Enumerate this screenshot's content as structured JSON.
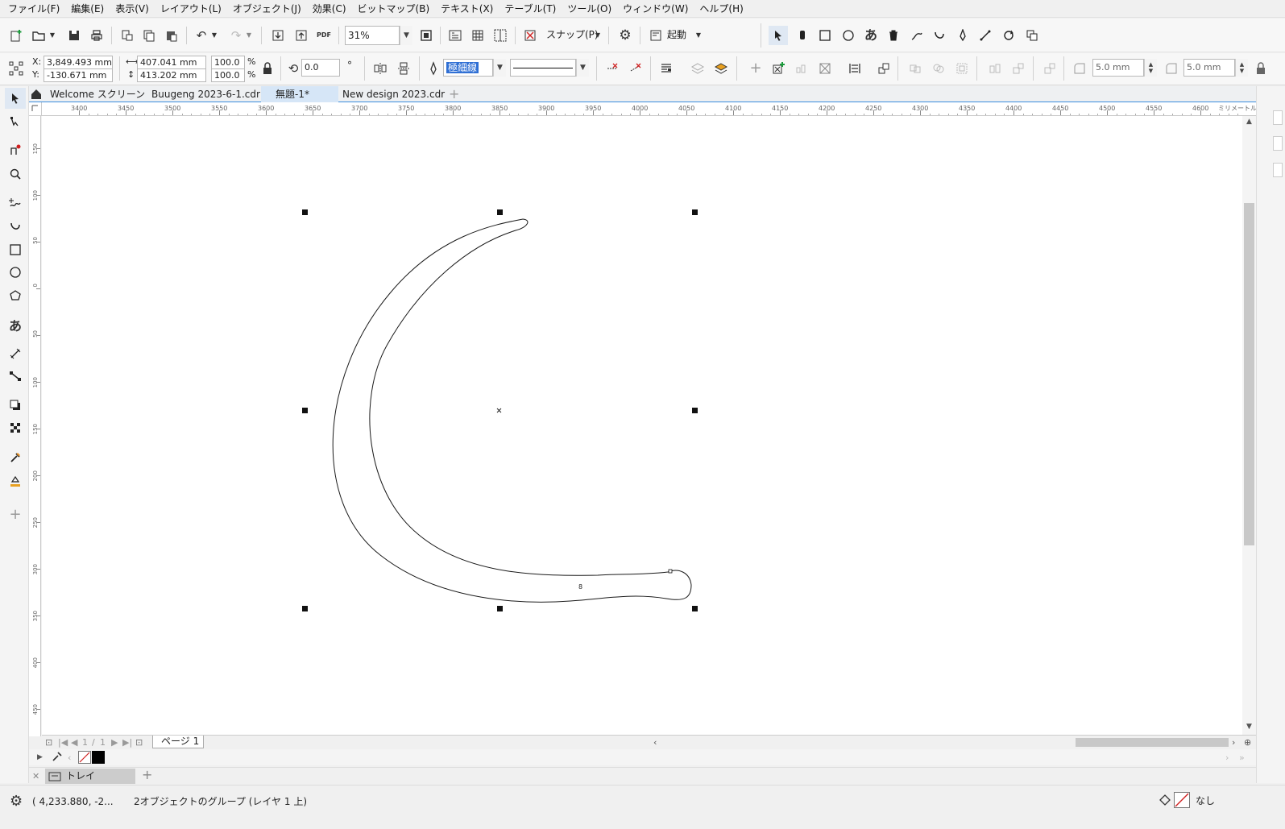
{
  "menu": [
    "ファイル(F)",
    "編集(E)",
    "表示(V)",
    "レイアウト(L)",
    "オブジェクト(J)",
    "効果(C)",
    "ビットマップ(B)",
    "テキスト(X)",
    "テーブル(T)",
    "ツール(O)",
    "ウィンドウ(W)",
    "ヘルプ(H)"
  ],
  "toolbar": {
    "zoom": "31%",
    "pdf_label": "PDF",
    "snap_label": "スナップ(P)",
    "launch_label": "起動"
  },
  "property_bar": {
    "x_label": "X:",
    "y_label": "Y:",
    "x_value": "3,849.493 mm",
    "y_value": "-130.671 mm",
    "width_value": "407.041 mm",
    "height_value": "413.202 mm",
    "scale_w": "100.0",
    "scale_h": "100.0",
    "percent": "%",
    "rotation": "0.0",
    "degree": "°",
    "outline_width": "極細線",
    "corner_a": "5.0 mm",
    "corner_b": "5.0 mm"
  },
  "tabs": [
    "Welcome スクリーン",
    "Buugeng 2023-6-1.cdr",
    "無題-1*",
    "New design 2023.cdr"
  ],
  "active_tab": "無題-1*",
  "ruler": {
    "h_ticks": [
      "3400",
      "3450",
      "3500",
      "3550",
      "3600",
      "3650",
      "3700",
      "3750",
      "3800",
      "3850",
      "3900",
      "3950",
      "4000",
      "4050",
      "4100",
      "4150",
      "4200",
      "4250",
      "4300",
      "4350",
      "4400",
      "4450",
      "4500",
      "4550",
      "4600"
    ],
    "h_unit": "ミリメートル",
    "v_ticks": [
      "150",
      "100",
      "50",
      "0",
      "50",
      "100",
      "150",
      "200",
      "250",
      "300",
      "350",
      "400",
      "450"
    ]
  },
  "page_nav": {
    "current": "1",
    "sep": "/",
    "total": "1",
    "page_tab": "ページ 1"
  },
  "tray": {
    "label": "トレイ"
  },
  "status": {
    "cursor": "( 4,233.880, -2...",
    "selection": "2オブジェクトのグループ (レイヤ 1  上)",
    "fill_label": "なし"
  },
  "colors": {
    "accent": "#3c8dde",
    "active_tab": "#d6e6f7",
    "canvas": "#ffffff"
  }
}
